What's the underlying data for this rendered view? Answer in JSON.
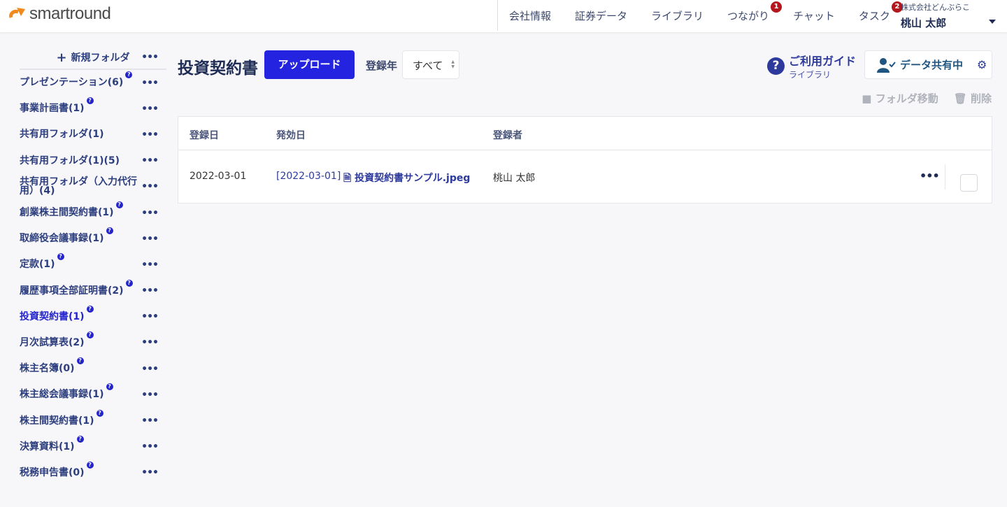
{
  "header": {
    "logo": "smartround",
    "nav": [
      {
        "label": "会社情報"
      },
      {
        "label": "証券データ"
      },
      {
        "label": "ライブラリ"
      },
      {
        "label": "つながり",
        "badge": "1"
      },
      {
        "label": "チャット"
      },
      {
        "label": "タスク",
        "badge": "2"
      }
    ],
    "company": "株式会社どんぶらこ",
    "user": "桃山 太郎"
  },
  "sidebar": {
    "new_folder": "新規フォルダ",
    "more": "•••",
    "items": [
      {
        "label": "プレゼンテーション(6)",
        "help": true
      },
      {
        "label": "事業計画書(1)",
        "help": true
      },
      {
        "label": "共有用フォルダ(1)",
        "help": false
      },
      {
        "label": "共有用フォルダ(1)(5)",
        "help": false
      },
      {
        "label": "共有用フォルダ（入力代行用）(4)",
        "help": false
      },
      {
        "label": "創業株主間契約書(1)",
        "help": true
      },
      {
        "label": "取締役会議事録(1)",
        "help": true
      },
      {
        "label": "定款(1)",
        "help": true
      },
      {
        "label": "履歴事項全部証明書(2)",
        "help": true
      },
      {
        "label": "投資契約書(1)",
        "help": true,
        "active": true
      },
      {
        "label": "月次試算表(2)",
        "help": true
      },
      {
        "label": "株主名簿(0)",
        "help": true
      },
      {
        "label": "株主総会議事録(1)",
        "help": true
      },
      {
        "label": "株主間契約書(1)",
        "help": true
      },
      {
        "label": "決算資料(1)",
        "help": true
      },
      {
        "label": "税務申告書(0)",
        "help": true
      }
    ]
  },
  "main": {
    "title": "投資契約書",
    "upload": "アップロード",
    "year_label": "登録年",
    "year_value": "すべて",
    "guide_title": "ご利用ガイド",
    "guide_sub": "ライブラリ",
    "share": "データ共有中",
    "move": "フォルダ移動",
    "delete": "削除",
    "columns": [
      "登録日",
      "発効日",
      "登録者"
    ],
    "rows": [
      {
        "registered": "2022-03-01",
        "effective": "[2022-03-01]",
        "file": "投資契約書サンプル.jpeg",
        "user": "桃山 太郎"
      }
    ]
  }
}
